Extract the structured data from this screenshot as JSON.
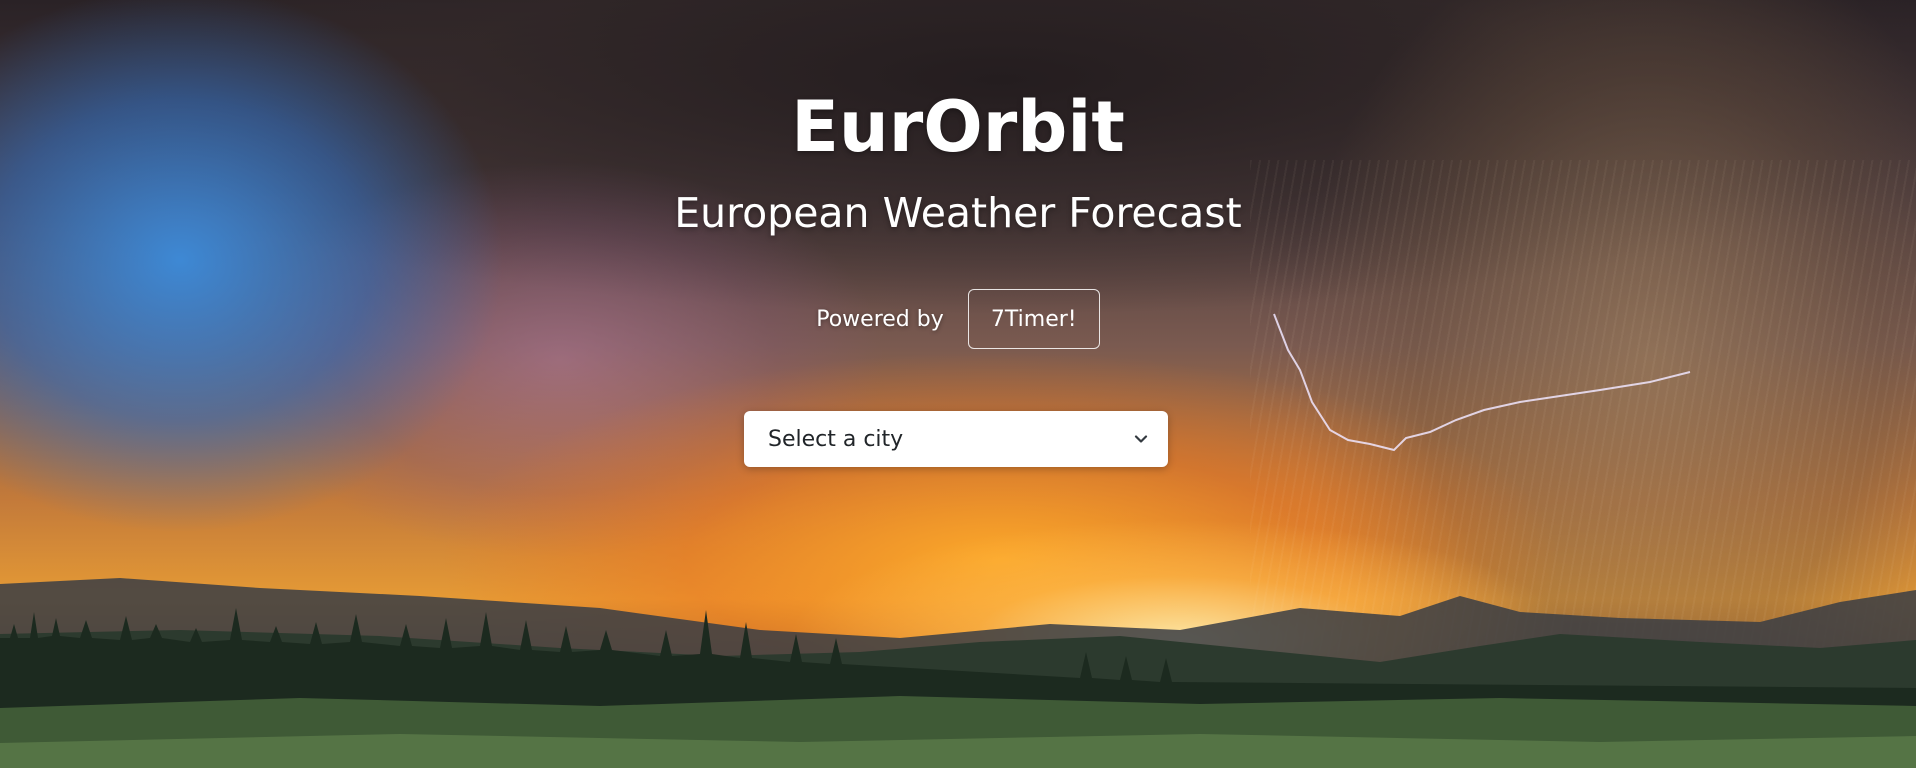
{
  "header": {
    "title": "EurOrbit",
    "subtitle": "European Weather Forecast"
  },
  "powered_by": {
    "label": "Powered by",
    "button_label": "7Timer!"
  },
  "city_select": {
    "selected_value": "Select a city",
    "icon": "chevron-down-icon"
  },
  "background": {
    "description_icon": "storm-sunset-landscape-image",
    "colors": {
      "sky_dark": "#2a2226",
      "sunset_orange": "#e59a35",
      "sky_blue": "#3c8cdc",
      "hills": "#1f2a22",
      "grass": "#3f5a36"
    }
  }
}
